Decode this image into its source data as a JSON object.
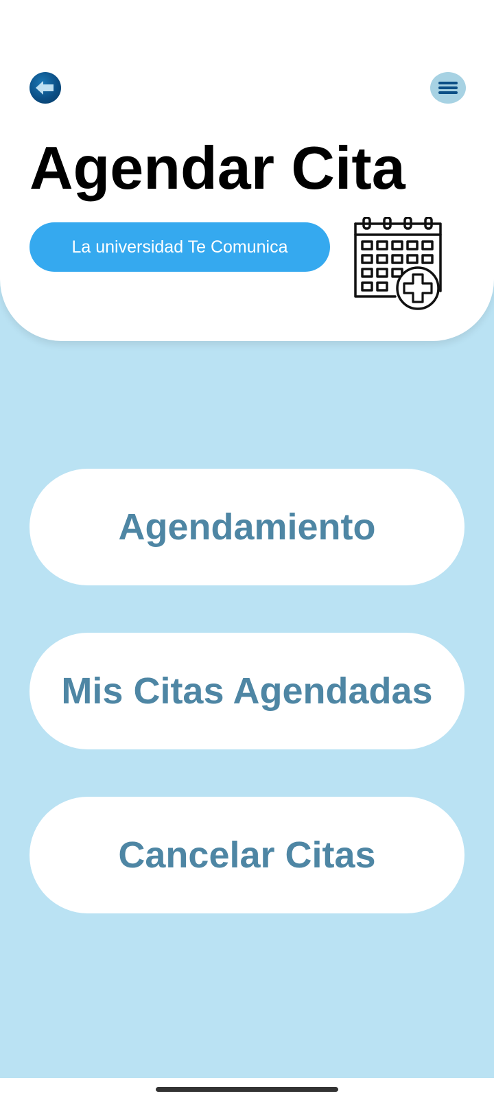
{
  "header": {
    "title": "Agendar Cita",
    "banner_text": "La universidad Te Comunica",
    "back_icon": "arrow-left-icon",
    "menu_icon": "hamburger-menu-icon",
    "illustration_icon": "calendar-add-icon"
  },
  "menu": {
    "options": [
      {
        "label": "Agendamiento"
      },
      {
        "label": "Mis Citas Agendadas"
      },
      {
        "label": "Cancelar Citas"
      }
    ]
  },
  "colors": {
    "background": "#bae2f3",
    "card": "#ffffff",
    "banner": "#35a9ef",
    "button_text": "#4e86a4",
    "back_button": "#0b4f86",
    "menu_button": "#a7d2e3"
  }
}
